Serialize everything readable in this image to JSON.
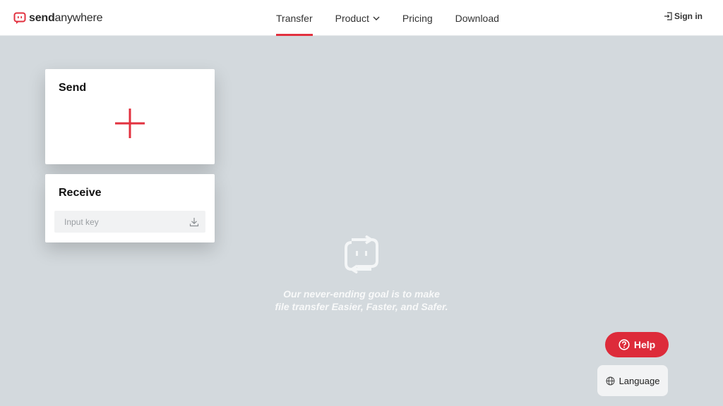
{
  "header": {
    "logo": {
      "text_bold": "send",
      "text_regular": "anywhere"
    },
    "nav": [
      {
        "label": "Transfer",
        "active": true
      },
      {
        "label": "Product",
        "dropdown": true
      },
      {
        "label": "Pricing"
      },
      {
        "label": "Download"
      }
    ],
    "signin_label": "Sign in"
  },
  "send_card": {
    "title": "Send",
    "icon": "plus-icon"
  },
  "receive_card": {
    "title": "Receive",
    "input_placeholder": "Input key",
    "icon": "download-icon"
  },
  "center": {
    "tagline_line1": "Our never-ending goal is to make",
    "tagline_line2": "file transfer Easier, Faster, and Safer."
  },
  "help_label": "Help",
  "language_label": "Language",
  "colors": {
    "accent": "#e2313f",
    "background": "#d3d9dd",
    "help_button": "#dd2b3a"
  }
}
